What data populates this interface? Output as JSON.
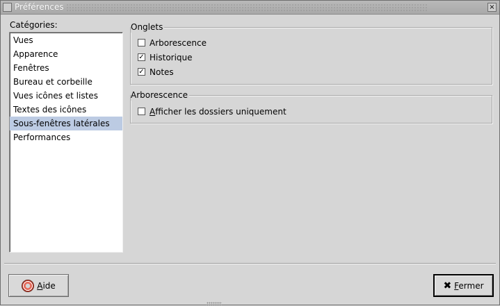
{
  "window": {
    "title": "Préférences",
    "close_glyph": "×"
  },
  "categories": {
    "label": "Catégories:",
    "items": [
      {
        "label": "Vues",
        "selected": false
      },
      {
        "label": "Apparence",
        "selected": false
      },
      {
        "label": "Fenêtres",
        "selected": false
      },
      {
        "label": "Bureau et corbeille",
        "selected": false
      },
      {
        "label": "Vues icônes et listes",
        "selected": false
      },
      {
        "label": "Textes des icônes",
        "selected": false
      },
      {
        "label": "Sous-fenêtres latérales",
        "selected": true
      },
      {
        "label": "Performances",
        "selected": false
      }
    ]
  },
  "onglets": {
    "legend": "Onglets",
    "options": [
      {
        "label": "Arborescence",
        "checked": false
      },
      {
        "label": "Historique",
        "checked": true
      },
      {
        "label": "Notes",
        "checked": true
      }
    ]
  },
  "arborescence": {
    "legend": "Arborescence",
    "options": [
      {
        "label_first": "A",
        "label_rest": "fficher les dossiers uniquement",
        "checked": false
      }
    ]
  },
  "buttons": {
    "help_first": "A",
    "help_rest": "ide",
    "close_first": "F",
    "close_rest": "ermer",
    "close_icon_glyph": "✖"
  },
  "icons": {
    "help": "lifebuoy-icon",
    "close": "x-icon"
  },
  "colors": {
    "selection": "#bccbe3",
    "background": "#d6d6d6"
  }
}
